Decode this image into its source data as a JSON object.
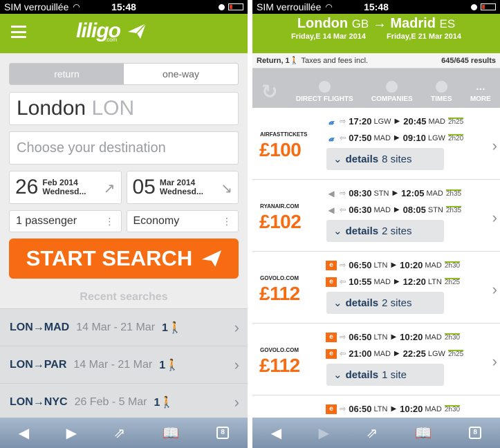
{
  "status": {
    "carrier": "SIM verrouillée",
    "time": "15:48"
  },
  "left": {
    "logo": "liligo",
    "logo_sub": ".com",
    "trip_toggle": [
      "return",
      "one-way"
    ],
    "origin": {
      "city": "London",
      "code": "LON"
    },
    "destination_placeholder": "Choose your destination",
    "depart": {
      "day": "26",
      "month": "Feb 2014",
      "weekday": "Wednesd..."
    },
    "return": {
      "day": "05",
      "month": "Mar 2014",
      "weekday": "Wednesd..."
    },
    "passengers": "1 passenger",
    "cabin": "Economy",
    "start_label": "START SEARCH",
    "recent_title": "Recent searches",
    "recent": [
      {
        "route": "LON→MAD",
        "dates": "14 Mar - 21 Mar",
        "pax": "1"
      },
      {
        "route": "LON→PAR",
        "dates": "14 Mar - 21 Mar",
        "pax": "1"
      },
      {
        "route": "LON→NYC",
        "dates": "26 Feb - 5 Mar",
        "pax": "1"
      }
    ]
  },
  "right": {
    "from_city": "London",
    "from_code": "GB",
    "to_city": "Madrid",
    "to_code": "ES",
    "out_date": "Friday,E 14 Mar 2014",
    "in_date": "Friday,E 21 Mar 2014",
    "sub_left": "Return, 1",
    "sub_taxes": "Taxes and fees incl.",
    "results_count": "645/645 results",
    "filters": [
      "DIRECT FLIGHTS",
      "COMPANIES",
      "TIMES",
      "MORE"
    ],
    "results": [
      {
        "airline": "AIRFASTTICKETS",
        "price": "£100",
        "details": "details",
        "sites": "8 sites",
        "legs": [
          {
            "dep": "17:20",
            "from": "LGW",
            "arr": "20:45",
            "to": "MAD",
            "dur": "2h25"
          },
          {
            "dep": "07:50",
            "from": "MAD",
            "arr": "09:10",
            "to": "LGW",
            "dur": "2h20"
          }
        ]
      },
      {
        "airline": "RYANAIR.COM",
        "price": "£102",
        "details": "details",
        "sites": "2 sites",
        "legs": [
          {
            "dep": "08:30",
            "from": "STN",
            "arr": "12:05",
            "to": "MAD",
            "dur": "2h35"
          },
          {
            "dep": "06:30",
            "from": "MAD",
            "arr": "08:05",
            "to": "STN",
            "dur": "2h35"
          }
        ]
      },
      {
        "airline": "GOVOLO.COM",
        "price": "£112",
        "details": "details",
        "sites": "2 sites",
        "legs": [
          {
            "dep": "06:50",
            "from": "LTN",
            "arr": "10:20",
            "to": "MAD",
            "dur": "2h30"
          },
          {
            "dep": "10:55",
            "from": "MAD",
            "arr": "12:20",
            "to": "LTN",
            "dur": "2h25"
          }
        ]
      },
      {
        "airline": "GOVOLO.COM",
        "price": "£112",
        "details": "details",
        "sites": "1 site",
        "legs": [
          {
            "dep": "06:50",
            "from": "LTN",
            "arr": "10:20",
            "to": "MAD",
            "dur": "2h30"
          },
          {
            "dep": "21:00",
            "from": "MAD",
            "arr": "22:25",
            "to": "LGW",
            "dur": "2h25"
          }
        ]
      },
      {
        "airline": "",
        "price": "",
        "details": "",
        "sites": "",
        "legs": [
          {
            "dep": "06:50",
            "from": "LTN",
            "arr": "10:20",
            "to": "MAD",
            "dur": "2h30"
          }
        ]
      }
    ]
  },
  "toolbar": {
    "tabs_count": "8"
  },
  "colors": {
    "brand_green": "#8dbd1b",
    "accent_orange": "#f76c13"
  }
}
